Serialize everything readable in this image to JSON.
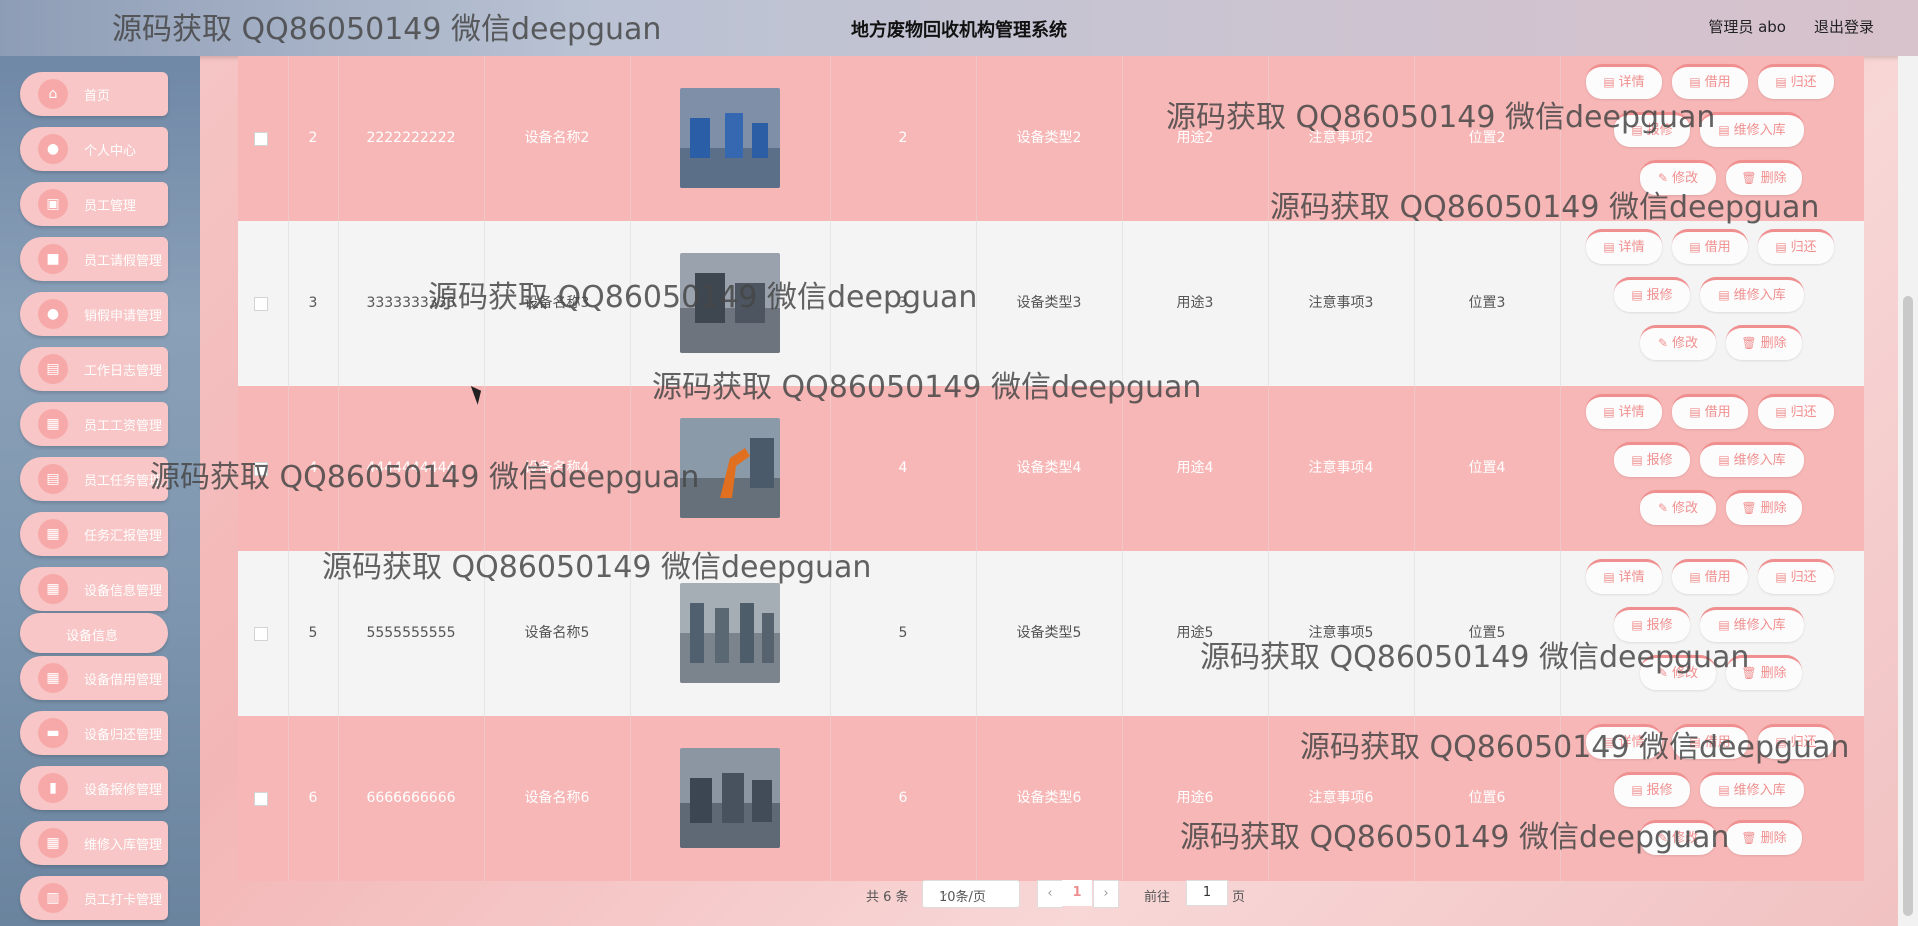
{
  "header": {
    "title": "地方废物回收机构管理系统",
    "admin": "管理员 abo",
    "logout": "退出登录"
  },
  "watermark": "源码获取 QQ86050149 微信deepguan",
  "sidebar": {
    "items": [
      {
        "label": "首页",
        "icon": "home-icon"
      },
      {
        "label": "个人中心",
        "icon": "user-icon"
      },
      {
        "label": "员工管理",
        "icon": "group-icon"
      },
      {
        "label": "员工请假管理",
        "icon": "briefcase-icon"
      },
      {
        "label": "销假申请管理",
        "icon": "location-icon"
      },
      {
        "label": "工作日志管理",
        "icon": "clipboard-icon"
      },
      {
        "label": "员工工资管理",
        "icon": "grid-icon"
      },
      {
        "label": "员工任务管理",
        "icon": "clipboard-icon"
      },
      {
        "label": "任务汇报管理",
        "icon": "grid-icon"
      },
      {
        "label": "设备信息管理",
        "icon": "grid-icon"
      },
      {
        "label": "设备信息",
        "icon": ""
      },
      {
        "label": "设备借用管理",
        "icon": "grid-icon"
      },
      {
        "label": "设备归还管理",
        "icon": "chat-icon"
      },
      {
        "label": "设备报修管理",
        "icon": "chart-icon"
      },
      {
        "label": "维修入库管理",
        "icon": "grid-icon"
      },
      {
        "label": "员工打卡管理",
        "icon": "bar-chart-icon"
      }
    ]
  },
  "rows": [
    {
      "id": "2",
      "code": "2222222222",
      "name": "设备名称2",
      "num": "2",
      "type": "设备类型2",
      "use": "用途2",
      "note": "注意事项2",
      "loc": "位置2"
    },
    {
      "id": "3",
      "code": "3333333333",
      "name": "设备名称3",
      "num": "3",
      "type": "设备类型3",
      "use": "用途3",
      "note": "注意事项3",
      "loc": "位置3"
    },
    {
      "id": "4",
      "code": "4444444444",
      "name": "设备名称4",
      "num": "4",
      "type": "设备类型4",
      "use": "用途4",
      "note": "注意事项4",
      "loc": "位置4"
    },
    {
      "id": "5",
      "code": "5555555555",
      "name": "设备名称5",
      "num": "5",
      "type": "设备类型5",
      "use": "用途5",
      "note": "注意事项5",
      "loc": "位置5"
    },
    {
      "id": "6",
      "code": "6666666666",
      "name": "设备名称6",
      "num": "6",
      "type": "设备类型6",
      "use": "用途6",
      "note": "注意事项6",
      "loc": "位置6"
    }
  ],
  "actions": {
    "detail": "详情",
    "borrow": "借用",
    "return": "归还",
    "repair": "报修",
    "store": "维修入库",
    "edit": "修改",
    "delete": "删除"
  },
  "pager": {
    "total": "共 6 条",
    "size": "10条/页",
    "current": "1",
    "goto": "前往",
    "goto_value": "1",
    "page": "页"
  },
  "colors": {
    "accent": "#f08f8f",
    "row_pink": "#f8b7b7",
    "row_gray": "#f4f4f4"
  }
}
